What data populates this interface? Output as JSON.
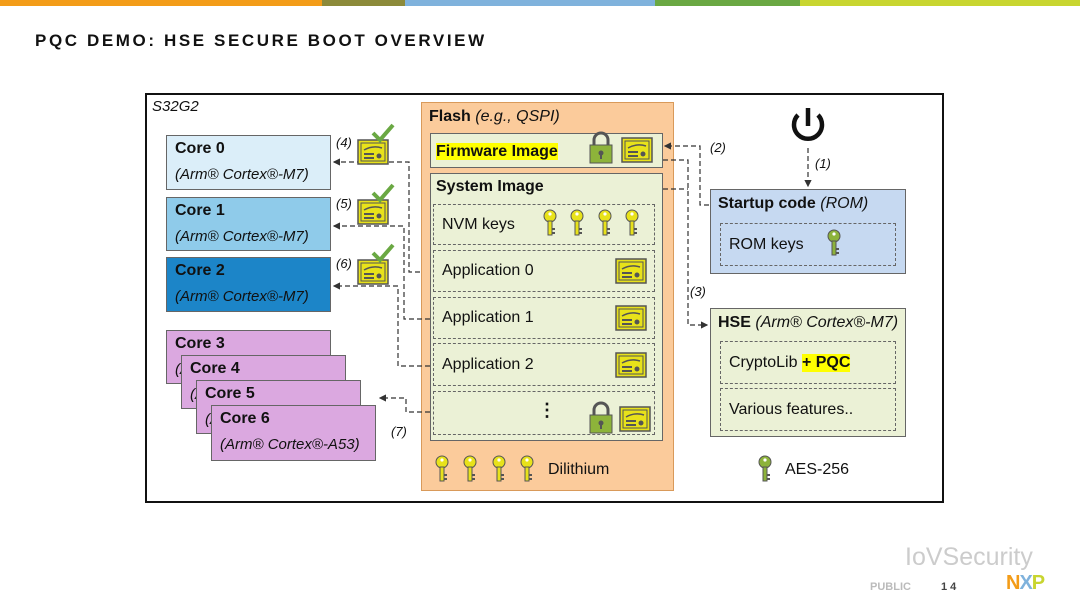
{
  "colors": {
    "bar": [
      "#f39c18",
      "#8c8a3a",
      "#7fb2dc",
      "#6aa843",
      "#c8d530"
    ],
    "core0": "#dbeef9",
    "core1": "#8fcbea",
    "core2": "#1c85c8",
    "core_a53": "#dba8e0",
    "flash": "#fbcb9b",
    "image": "#ebf1d6",
    "rom": "#c6d9f1",
    "key": "#e8e21a",
    "key_aes": "#8db33a"
  },
  "title": "PQC DEMO: HSE SECURE BOOT OVERVIEW",
  "chip": "S32G2",
  "cores": [
    {
      "name": "Core 0",
      "desc": "(Arm® Cortex®-M7)"
    },
    {
      "name": "Core 1",
      "desc": "(Arm® Cortex®-M7)"
    },
    {
      "name": "Core 2",
      "desc": "(Arm® Cortex®-M7)"
    },
    {
      "name": "Core 3",
      "desc": "(A"
    },
    {
      "name": "Core 4",
      "desc": "(A"
    },
    {
      "name": "Core 5",
      "desc": "(A"
    },
    {
      "name": "Core 6",
      "desc": "(Arm® Cortex®-A53)"
    }
  ],
  "flash": {
    "title": "Flash",
    "subtitle": "(e.g., QSPI)",
    "firmware": "Firmware Image",
    "system": "System Image",
    "nvm": "NVM keys",
    "apps": [
      "Application 0",
      "Application 1",
      "Application 2"
    ],
    "more": "⋮",
    "dilithium": "Dilithium"
  },
  "startup": {
    "title": "Startup code",
    "subtitle": "(ROM)",
    "rom_keys": "ROM keys"
  },
  "hse": {
    "title": "HSE",
    "subtitle": "(Arm® Cortex®-M7)",
    "cryptolib": "CryptoLib",
    "pqc": "+ PQC",
    "features": "Various features.."
  },
  "aes": "AES-256",
  "steps": [
    "(1)",
    "(2)",
    "(3)",
    "(4)",
    "(5)",
    "(6)",
    "(7)"
  ],
  "footer": {
    "public": "PUBLIC",
    "page": "1 4",
    "watermark": "IoVSecurity",
    "logo": "NXP"
  }
}
